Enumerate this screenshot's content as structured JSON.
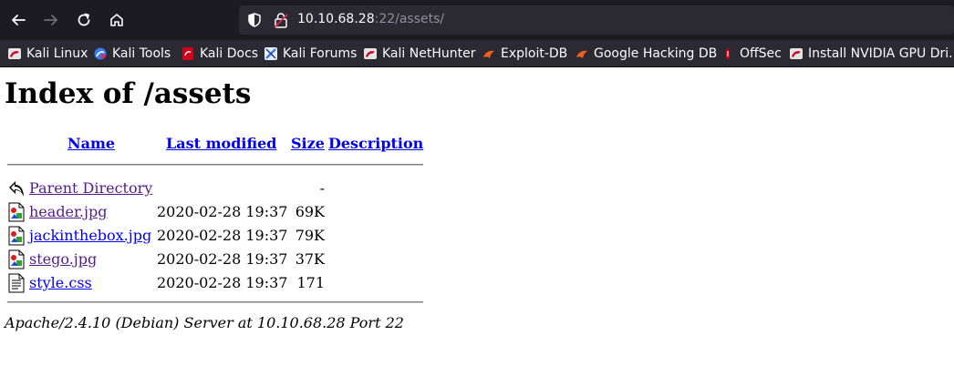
{
  "browser": {
    "url_host": "10.10.68.28",
    "url_rest": ":22/assets/",
    "bookmarks": [
      {
        "label": "Kali Linux",
        "icon": "kali-dragon-icon"
      },
      {
        "label": "Kali Tools",
        "icon": "kali-tools-icon"
      },
      {
        "label": "Kali Docs",
        "icon": "kali-docs-icon"
      },
      {
        "label": "Kali Forums",
        "icon": "kali-forums-icon"
      },
      {
        "label": "Kali NetHunter",
        "icon": "kali-dragon-icon"
      },
      {
        "label": "Exploit-DB",
        "icon": "exploit-db-icon"
      },
      {
        "label": "Google Hacking DB",
        "icon": "exploit-db-icon"
      },
      {
        "label": "OffSec",
        "icon": "offsec-icon"
      },
      {
        "label": "Install NVIDIA GPU Dri...",
        "icon": "kali-dragon-icon"
      }
    ]
  },
  "page": {
    "title": "Index of /assets",
    "headers": {
      "name": "Name",
      "last_modified": "Last modified",
      "size": "Size",
      "description": "Description"
    },
    "rows": [
      {
        "name": "Parent Directory",
        "date": "",
        "size": "-",
        "icon": "back-arrow-icon",
        "visited": true
      },
      {
        "name": "header.jpg",
        "date": "2020-02-28 19:37",
        "size": "69K",
        "icon": "image-file-icon",
        "visited": true
      },
      {
        "name": "jackinthebox.jpg",
        "date": "2020-02-28 19:37",
        "size": "79K",
        "icon": "image-file-icon",
        "visited": false
      },
      {
        "name": "stego.jpg",
        "date": "2020-02-28 19:37",
        "size": "37K",
        "icon": "image-file-icon",
        "visited": true
      },
      {
        "name": "style.css",
        "date": "2020-02-28 19:37",
        "size": "171",
        "icon": "text-file-icon",
        "visited": false
      }
    ],
    "address": "Apache/2.4.10 (Debian) Server at 10.10.68.28 Port 22"
  }
}
